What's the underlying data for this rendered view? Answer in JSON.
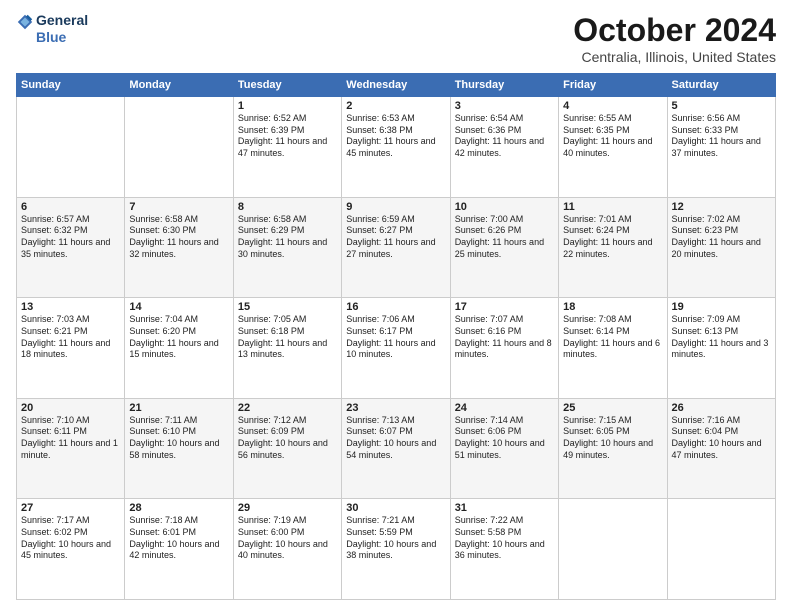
{
  "logo": {
    "line1": "General",
    "line2": "Blue"
  },
  "title": "October 2024",
  "subtitle": "Centralia, Illinois, United States",
  "days_of_week": [
    "Sunday",
    "Monday",
    "Tuesday",
    "Wednesday",
    "Thursday",
    "Friday",
    "Saturday"
  ],
  "weeks": [
    [
      {
        "day": "",
        "info": ""
      },
      {
        "day": "",
        "info": ""
      },
      {
        "day": "1",
        "info": "Sunrise: 6:52 AM\nSunset: 6:39 PM\nDaylight: 11 hours and 47 minutes."
      },
      {
        "day": "2",
        "info": "Sunrise: 6:53 AM\nSunset: 6:38 PM\nDaylight: 11 hours and 45 minutes."
      },
      {
        "day": "3",
        "info": "Sunrise: 6:54 AM\nSunset: 6:36 PM\nDaylight: 11 hours and 42 minutes."
      },
      {
        "day": "4",
        "info": "Sunrise: 6:55 AM\nSunset: 6:35 PM\nDaylight: 11 hours and 40 minutes."
      },
      {
        "day": "5",
        "info": "Sunrise: 6:56 AM\nSunset: 6:33 PM\nDaylight: 11 hours and 37 minutes."
      }
    ],
    [
      {
        "day": "6",
        "info": "Sunrise: 6:57 AM\nSunset: 6:32 PM\nDaylight: 11 hours and 35 minutes."
      },
      {
        "day": "7",
        "info": "Sunrise: 6:58 AM\nSunset: 6:30 PM\nDaylight: 11 hours and 32 minutes."
      },
      {
        "day": "8",
        "info": "Sunrise: 6:58 AM\nSunset: 6:29 PM\nDaylight: 11 hours and 30 minutes."
      },
      {
        "day": "9",
        "info": "Sunrise: 6:59 AM\nSunset: 6:27 PM\nDaylight: 11 hours and 27 minutes."
      },
      {
        "day": "10",
        "info": "Sunrise: 7:00 AM\nSunset: 6:26 PM\nDaylight: 11 hours and 25 minutes."
      },
      {
        "day": "11",
        "info": "Sunrise: 7:01 AM\nSunset: 6:24 PM\nDaylight: 11 hours and 22 minutes."
      },
      {
        "day": "12",
        "info": "Sunrise: 7:02 AM\nSunset: 6:23 PM\nDaylight: 11 hours and 20 minutes."
      }
    ],
    [
      {
        "day": "13",
        "info": "Sunrise: 7:03 AM\nSunset: 6:21 PM\nDaylight: 11 hours and 18 minutes."
      },
      {
        "day": "14",
        "info": "Sunrise: 7:04 AM\nSunset: 6:20 PM\nDaylight: 11 hours and 15 minutes."
      },
      {
        "day": "15",
        "info": "Sunrise: 7:05 AM\nSunset: 6:18 PM\nDaylight: 11 hours and 13 minutes."
      },
      {
        "day": "16",
        "info": "Sunrise: 7:06 AM\nSunset: 6:17 PM\nDaylight: 11 hours and 10 minutes."
      },
      {
        "day": "17",
        "info": "Sunrise: 7:07 AM\nSunset: 6:16 PM\nDaylight: 11 hours and 8 minutes."
      },
      {
        "day": "18",
        "info": "Sunrise: 7:08 AM\nSunset: 6:14 PM\nDaylight: 11 hours and 6 minutes."
      },
      {
        "day": "19",
        "info": "Sunrise: 7:09 AM\nSunset: 6:13 PM\nDaylight: 11 hours and 3 minutes."
      }
    ],
    [
      {
        "day": "20",
        "info": "Sunrise: 7:10 AM\nSunset: 6:11 PM\nDaylight: 11 hours and 1 minute."
      },
      {
        "day": "21",
        "info": "Sunrise: 7:11 AM\nSunset: 6:10 PM\nDaylight: 10 hours and 58 minutes."
      },
      {
        "day": "22",
        "info": "Sunrise: 7:12 AM\nSunset: 6:09 PM\nDaylight: 10 hours and 56 minutes."
      },
      {
        "day": "23",
        "info": "Sunrise: 7:13 AM\nSunset: 6:07 PM\nDaylight: 10 hours and 54 minutes."
      },
      {
        "day": "24",
        "info": "Sunrise: 7:14 AM\nSunset: 6:06 PM\nDaylight: 10 hours and 51 minutes."
      },
      {
        "day": "25",
        "info": "Sunrise: 7:15 AM\nSunset: 6:05 PM\nDaylight: 10 hours and 49 minutes."
      },
      {
        "day": "26",
        "info": "Sunrise: 7:16 AM\nSunset: 6:04 PM\nDaylight: 10 hours and 47 minutes."
      }
    ],
    [
      {
        "day": "27",
        "info": "Sunrise: 7:17 AM\nSunset: 6:02 PM\nDaylight: 10 hours and 45 minutes."
      },
      {
        "day": "28",
        "info": "Sunrise: 7:18 AM\nSunset: 6:01 PM\nDaylight: 10 hours and 42 minutes."
      },
      {
        "day": "29",
        "info": "Sunrise: 7:19 AM\nSunset: 6:00 PM\nDaylight: 10 hours and 40 minutes."
      },
      {
        "day": "30",
        "info": "Sunrise: 7:21 AM\nSunset: 5:59 PM\nDaylight: 10 hours and 38 minutes."
      },
      {
        "day": "31",
        "info": "Sunrise: 7:22 AM\nSunset: 5:58 PM\nDaylight: 10 hours and 36 minutes."
      },
      {
        "day": "",
        "info": ""
      },
      {
        "day": "",
        "info": ""
      }
    ]
  ]
}
